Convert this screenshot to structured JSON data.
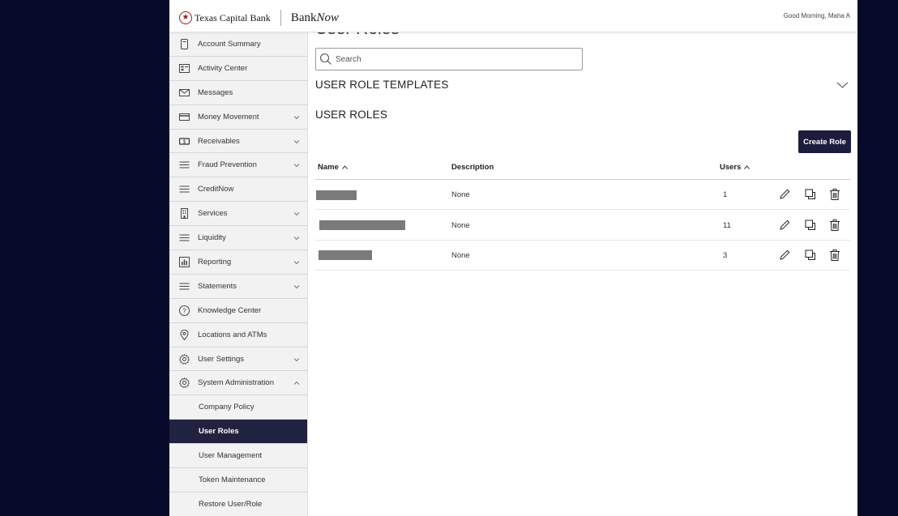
{
  "header": {
    "brand": "Texas Capital Bank",
    "product_main": "Bank",
    "product_italic": "Now",
    "greeting": "Good Morning, Maha A"
  },
  "sidebar": {
    "items": [
      {
        "label": "Account Summary",
        "icon": "account-summary-icon",
        "chevron": null
      },
      {
        "label": "Activity Center",
        "icon": "activity-center-icon",
        "chevron": null
      },
      {
        "label": "Messages",
        "icon": "envelope-icon",
        "chevron": null
      },
      {
        "label": "Money Movement",
        "icon": "card-icon",
        "chevron": "down"
      },
      {
        "label": "Receivables",
        "icon": "dollar-bill-icon",
        "chevron": "down"
      },
      {
        "label": "Fraud Prevention",
        "icon": "menu-lines-icon",
        "chevron": "down"
      },
      {
        "label": "CreditNow",
        "icon": "menu-lines-icon",
        "chevron": null
      },
      {
        "label": "Services",
        "icon": "building-icon",
        "chevron": "down"
      },
      {
        "label": "Liquidity",
        "icon": "menu-lines-icon",
        "chevron": "down"
      },
      {
        "label": "Reporting",
        "icon": "bar-chart-icon",
        "chevron": "down"
      },
      {
        "label": "Statements",
        "icon": "menu-lines-icon",
        "chevron": "down"
      },
      {
        "label": "Knowledge Center",
        "icon": "question-circle-icon",
        "chevron": null
      },
      {
        "label": "Locations and ATMs",
        "icon": "location-pin-icon",
        "chevron": null
      },
      {
        "label": "User Settings",
        "icon": "gear-icon",
        "chevron": "down"
      },
      {
        "label": "System Administration",
        "icon": "gear-icon",
        "chevron": "up"
      }
    ],
    "sub_items": [
      {
        "label": "Company Policy",
        "active": false
      },
      {
        "label": "User Roles",
        "active": true
      },
      {
        "label": "User Management",
        "active": false
      },
      {
        "label": "Token Maintenance",
        "active": false
      },
      {
        "label": "Restore User/Role",
        "active": false
      }
    ]
  },
  "main": {
    "page_title": "User Roles",
    "search_placeholder": "Search",
    "templates_heading": "USER ROLE TEMPLATES",
    "roles_heading": "USER ROLES",
    "create_button": "Create Role",
    "table": {
      "columns": {
        "name": "Name",
        "description": "Description",
        "users": "Users"
      },
      "rows": [
        {
          "name": "[redacted]",
          "description": "None",
          "users": "1"
        },
        {
          "name": "[redacted]",
          "description": "None",
          "users": "11"
        },
        {
          "name": "[redacted]",
          "description": "None",
          "users": "3"
        }
      ]
    }
  },
  "colors": {
    "page_background": "#080a2b",
    "active_nav": "#212140",
    "primary_button": "#1c1c3f",
    "brand_red": "#9b1b1b"
  }
}
